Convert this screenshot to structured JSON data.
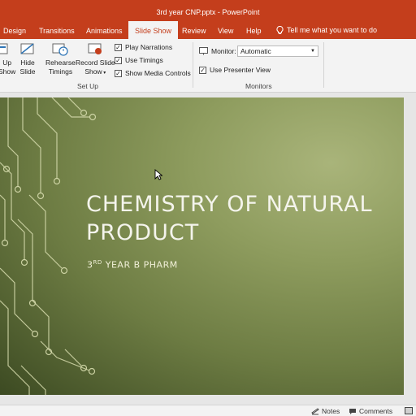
{
  "window": {
    "title": "3rd year CNP.pptx  -  PowerPoint"
  },
  "tabs": [
    {
      "label": "Design"
    },
    {
      "label": "Transitions"
    },
    {
      "label": "Animations"
    },
    {
      "label": "Slide Show",
      "active": true
    },
    {
      "label": "Review"
    },
    {
      "label": "View"
    },
    {
      "label": "Help"
    }
  ],
  "tell_me": "Tell me what you want to do",
  "ribbon": {
    "setup_partial": {
      "line1": "Up",
      "line2": "Show"
    },
    "hide_slide": {
      "line1": "Hide",
      "line2": "Slide"
    },
    "rehearse": {
      "line1": "Rehearse",
      "line2": "Timings"
    },
    "record": {
      "line1": "Record Slide",
      "line2": "Show"
    },
    "play_narrations": "Play Narrations",
    "use_timings": "Use Timings",
    "show_media_controls": "Show Media Controls",
    "setup_group": "Set Up",
    "monitor_label": "Monitor:",
    "monitor_value": "Automatic",
    "presenter_view": "Use Presenter View",
    "monitors_group": "Monitors"
  },
  "slide": {
    "title": "CHEMISTRY OF NATURAL PRODUCT",
    "subtitle_num": "3",
    "subtitle_sup": "RD",
    "subtitle_rest": " YEAR B PHARM"
  },
  "status": {
    "notes": "Notes",
    "comments": "Comments"
  },
  "colors": {
    "accent": "#c43e1c",
    "slide_dark": "#3c4a22",
    "slide_light": "#a9b47a"
  }
}
